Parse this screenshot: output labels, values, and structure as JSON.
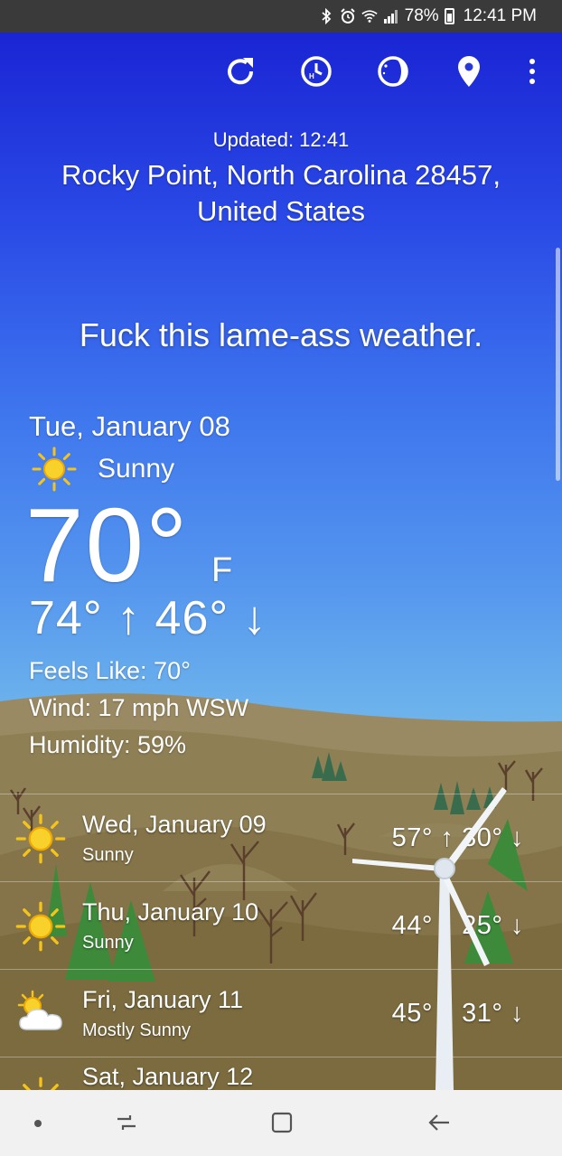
{
  "status_bar": {
    "battery": "78%",
    "time": "12:41 PM"
  },
  "header": {
    "updated": "Updated: 12:41",
    "location": "Rocky Point, North Carolina 28457, United States"
  },
  "tagline": "Fuck this lame-ass weather.",
  "current": {
    "date": "Tue, January 08",
    "condition": "Sunny",
    "temperature": "70°",
    "unit": "F",
    "hilo": "74° ↑ 46° ↓",
    "feels_like": "Feels Like: 70°",
    "wind": "Wind: 17 mph WSW",
    "humidity": "Humidity: 59%"
  },
  "forecast": [
    {
      "day": "Wed, January 09",
      "condition": "Sunny",
      "temps": "57° ↑ 30° ↓",
      "icon": "sun-icon"
    },
    {
      "day": "Thu, January 10",
      "condition": "Sunny",
      "temps": "44° ↑ 25° ↓",
      "icon": "sun-icon"
    },
    {
      "day": "Fri, January 11",
      "condition": "Mostly Sunny",
      "temps": "45° ↑ 31° ↓",
      "icon": "partly-cloudy-icon"
    },
    {
      "day": "Sat, January 12",
      "condition": "",
      "temps": "",
      "icon": "sun-icon"
    }
  ],
  "toolbar_icons": [
    "refresh-icon",
    "hourly-icon",
    "moon-icon",
    "location-pin-icon",
    "more-vert-icon"
  ],
  "nav_icons": [
    "nav-dot-icon",
    "recents-icon",
    "home-icon",
    "back-icon"
  ],
  "colors": {
    "sky_top": "#1a25d4",
    "sky_bottom": "#7bbbe8",
    "sun": "#f6c419",
    "ground": "#8a7a4e"
  }
}
